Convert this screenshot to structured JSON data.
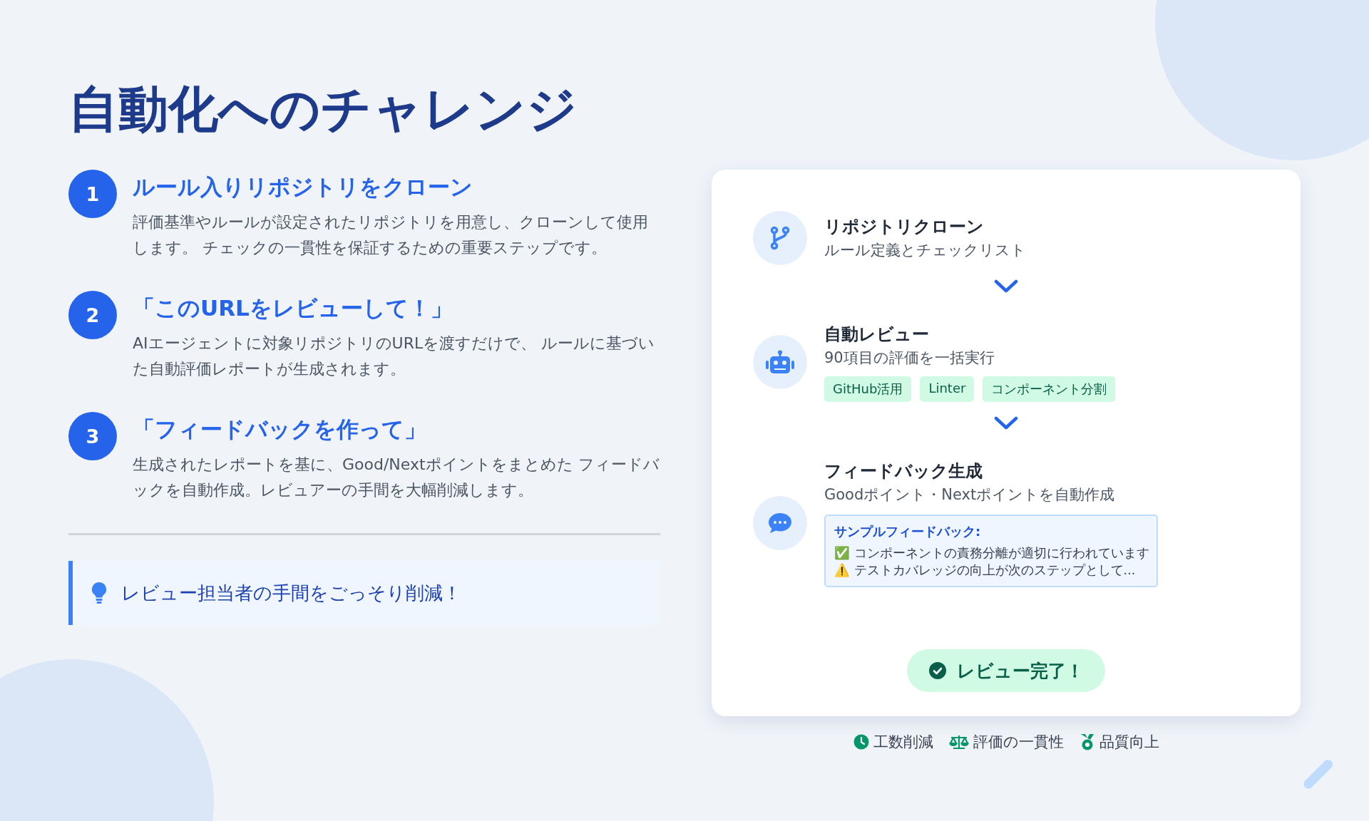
{
  "title": "自動化へのチャレンジ",
  "steps": [
    {
      "number": "1",
      "heading": "ルール入りリポジトリをクローン",
      "body": "評価基準やルールが設定されたリポジトリを用意し、クローンして使用します。 チェックの一貫性を保証するための重要ステップです。"
    },
    {
      "number": "2",
      "heading": "「このURLをレビューして！」",
      "body": "AIエージェントに対象リポジトリのURLを渡すだけで、 ルールに基づいた自動評価レポートが生成されます。"
    },
    {
      "number": "3",
      "heading": "「フィードバックを作って」",
      "body": "生成されたレポートを基に、Good/Nextポイントをまとめた フィードバックを自動作成。レビュアーの手間を大幅削減します。"
    }
  ],
  "callout": {
    "text": "レビュー担当者の手間をごっそり削減！"
  },
  "flow": [
    {
      "kind": "clone",
      "title": "リポジトリクローン",
      "subtitle": "ルール定義とチェックリスト"
    },
    {
      "kind": "review",
      "title": "自動レビュー",
      "subtitle": "90項目の評価を一括実行",
      "tags": [
        "GitHub活用",
        "Linter",
        "コンポーネント分割"
      ]
    },
    {
      "kind": "feedback",
      "title": "フィードバック生成",
      "subtitle": "Goodポイント・Nextポイントを自動作成",
      "sample": {
        "heading": "サンプルフィードバック:",
        "lines": [
          "✅ コンポーネントの責務分離が適切に行われています",
          "⚠️ テストカバレッジの向上が次のステップとして..."
        ]
      }
    }
  ],
  "done_button": {
    "label": "レビュー完了！"
  },
  "benefits": [
    {
      "kind": "time",
      "label": "工数削減"
    },
    {
      "kind": "balance",
      "label": "評価の一貫性"
    },
    {
      "kind": "medal",
      "label": "品質向上"
    }
  ]
}
